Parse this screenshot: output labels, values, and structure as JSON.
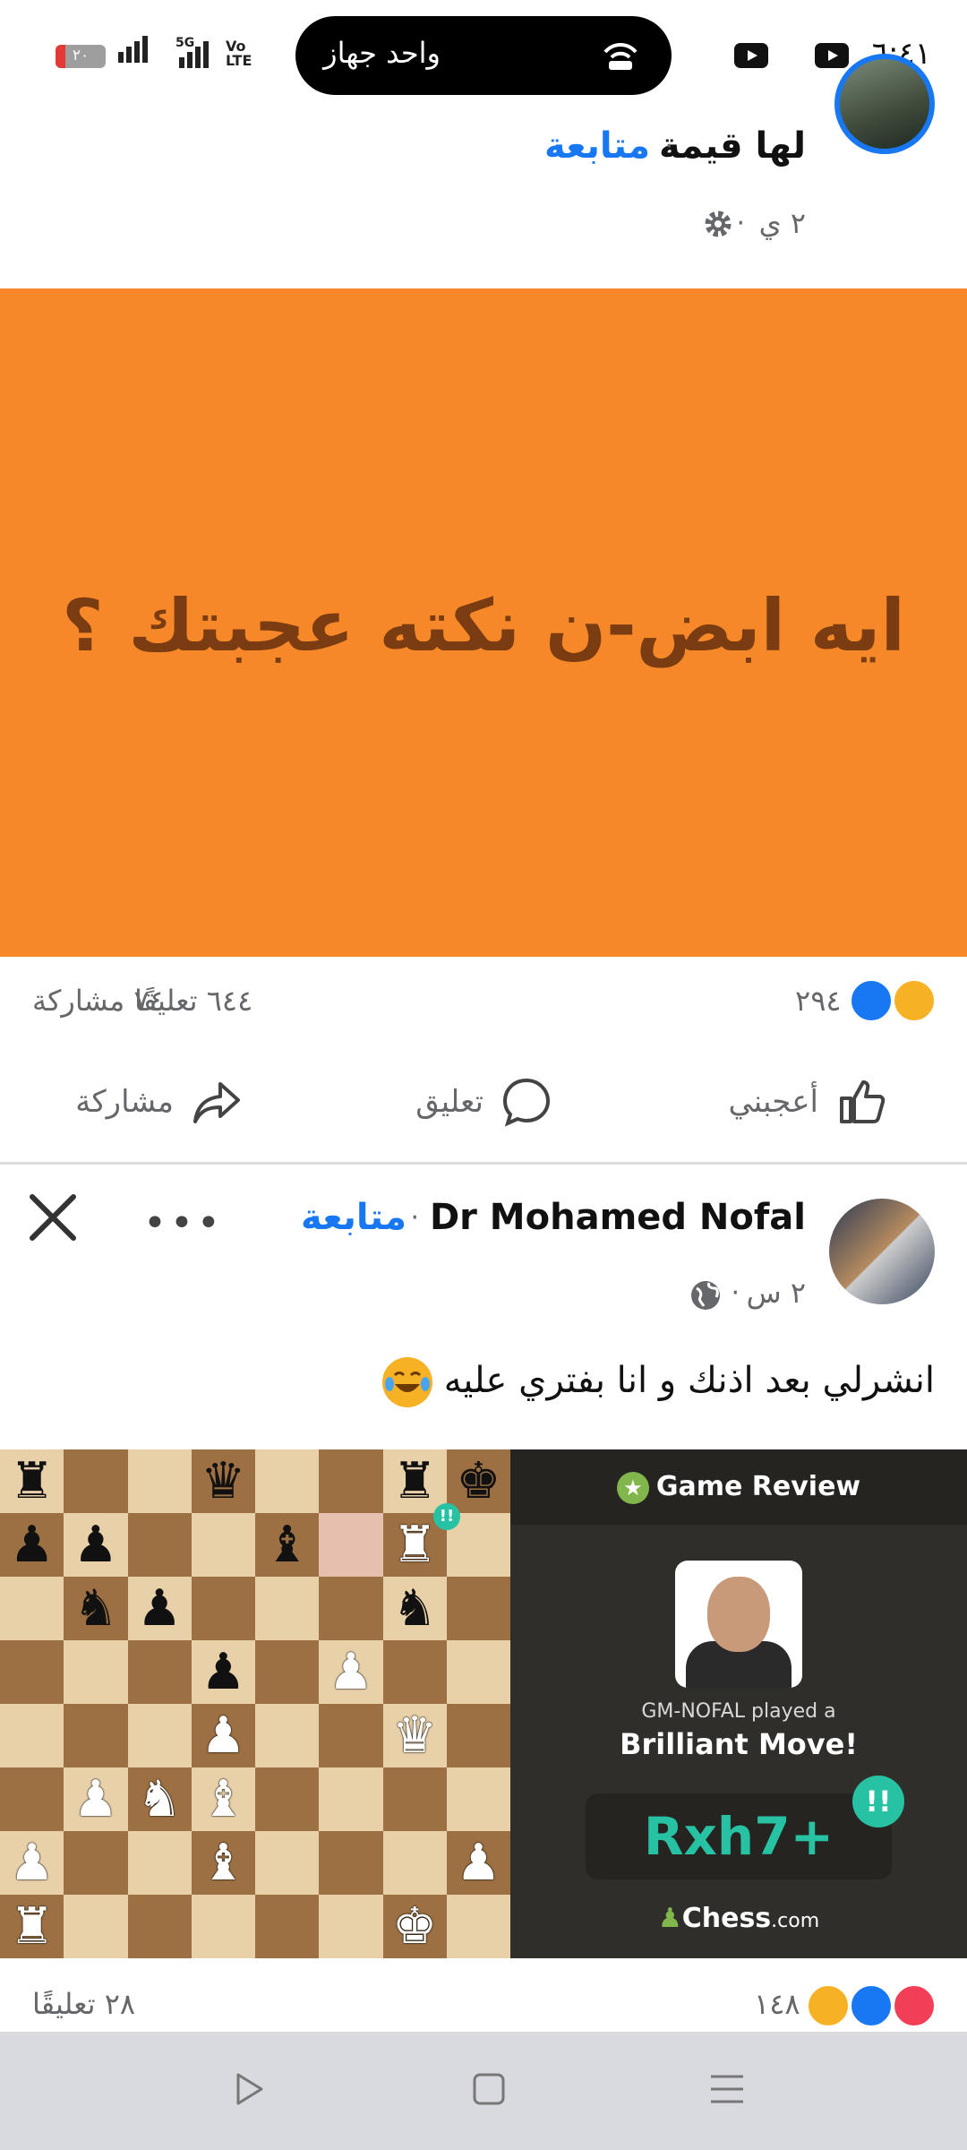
{
  "status_bar": {
    "time": "٦:٤١",
    "pill_text": "واحد جهاز",
    "battery_level": "٢٠",
    "battery_fraction": 0.2,
    "network_5g": "5G",
    "volte": "Vo",
    "lte": "LTE",
    "icons": [
      "youtube-icon",
      "youtube-icon",
      "hotspot-icon",
      "signal-icon",
      "battery-icon"
    ]
  },
  "post1": {
    "author": "لها قيمة",
    "follow": "متابعة",
    "time": "٢ ي",
    "privacy_icon": "gear-icon",
    "banner_text": "ايه ابض-ن نكته عجبتك ؟",
    "banner_color": "#f6882a",
    "reactions_count": "٢٩٤",
    "comments": "٦٤٤ تعليقًا",
    "shares": "٧٤ مشاركة",
    "actions": {
      "like": "أعجبني",
      "comment": "تعليق",
      "share": "مشاركة"
    }
  },
  "post2": {
    "author": "Dr Mohamed Nofal",
    "follow": "متابعة",
    "time": "٢ س",
    "privacy_icon": "globe-icon",
    "caption": "انشرلي بعد اذنك و انا بفتري عليه",
    "review": {
      "title": "Game Review",
      "played": "GM-NOFAL played a",
      "brilliant": "Brilliant Move!",
      "move": "Rxh7+",
      "badge": "!!",
      "logo_main": "Chess",
      "logo_suffix": ".com"
    },
    "reactions_count": "١٤٨",
    "comments": "٢٨ تعليقًا"
  },
  "accent": "#1877f2",
  "nav_icons": [
    "back-triangle-icon",
    "home-square-icon",
    "recents-menu-icon"
  ]
}
